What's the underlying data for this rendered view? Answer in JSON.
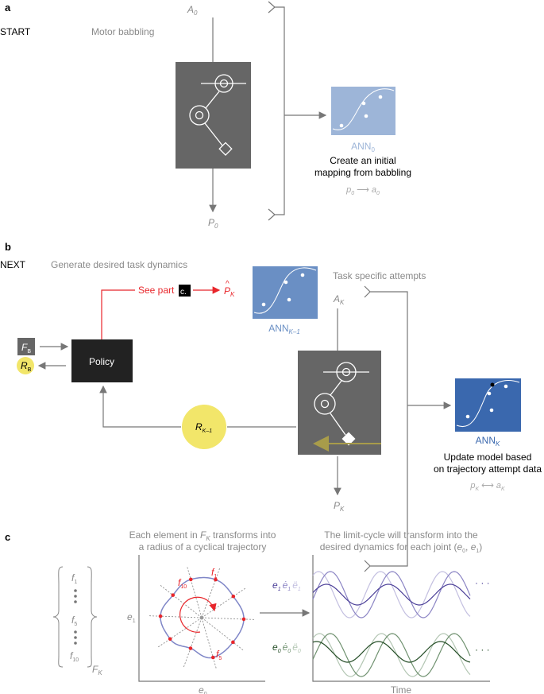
{
  "panel_a": {
    "letter": "a",
    "start": "START",
    "stage": "Motor babbling",
    "action": {
      "main": "A",
      "sub": "0"
    },
    "position": {
      "main": "P",
      "sub": "0"
    },
    "ann": {
      "main": "ANN",
      "sub": "0"
    },
    "caption": [
      "Create an initial",
      "mapping from babbling"
    ],
    "mapping": {
      "p": "p",
      "p_sub": "0",
      "arrow": "⟶",
      "a": "a",
      "a_sub": "0"
    }
  },
  "panel_b": {
    "letter": "b",
    "next": "NEXT",
    "stage": "Generate desired task dynamics",
    "see_part": "See part",
    "part_ref": "c.",
    "p_hat": {
      "main": "P",
      "hat": "^",
      "sub": "K"
    },
    "ann_prev": {
      "main": "ANN",
      "sub": "K–1"
    },
    "attempts": "Task specific attempts",
    "action": {
      "main": "A",
      "sub": "K"
    },
    "position": {
      "main": "P",
      "sub": "K"
    },
    "fb": {
      "main": "F",
      "sub": "B"
    },
    "rb": {
      "main": "R",
      "sub": "B"
    },
    "policy": "Policy",
    "reward": {
      "main": "R",
      "sub": "K–1"
    },
    "ann": {
      "main": "ANN",
      "sub": "K"
    },
    "caption": [
      "Update model based",
      "on trajectory attempt data"
    ],
    "mapping": {
      "p": "p",
      "p_sub": "K",
      "arrow": "⟷",
      "a": "a",
      "a_sub": "K"
    }
  },
  "panel_c": {
    "letter": "c",
    "left_title": [
      "Each element in ",
      "F",
      "K",
      " transforms into",
      "a radius of a cyclical trajectory"
    ],
    "right_title": [
      "The limit-cycle will transform into the",
      "desired dynamics for each joint (",
      "e",
      "0",
      ", ",
      "e",
      "1",
      ")"
    ],
    "vector": [
      {
        "main": "f",
        "sub": "1"
      },
      {
        "main": "f",
        "sub": "5"
      },
      {
        "main": "f",
        "sub": "10"
      }
    ],
    "vector_label": {
      "main": "F",
      "sub": "K"
    },
    "polar_labels": [
      {
        "main": "f",
        "sub": "1"
      },
      {
        "main": "f",
        "sub": "10"
      },
      {
        "main": "f",
        "sub": "5"
      }
    ],
    "x_axis": {
      "main": "e",
      "sub": "0"
    },
    "y_axis": {
      "main": "e",
      "sub": "1"
    },
    "time_axis": "Time",
    "e1_legend": {
      "main": "e",
      "sub": "1",
      "d1": "ė",
      "d2": "ë"
    },
    "e0_legend": {
      "main": "e",
      "sub": "0",
      "d1": "ė",
      "d2": "ë"
    },
    "ellipsis": "· · ·"
  },
  "colors": {
    "box_gray": "#666666",
    "ann0": "#9db5d8",
    "ann_prev": "#6a8fc4",
    "ann_k": "#3a68ae",
    "red": "#e8262b",
    "yellow": "#f2e66a",
    "yellow_arrow": "#a89c4a",
    "e1": [
      "#4b3f98",
      "#8b84c4",
      "#c3bfe0"
    ],
    "e0": [
      "#244d26",
      "#6f916f",
      "#b3c6b3"
    ],
    "limit_cycle": "#7f86c7"
  }
}
